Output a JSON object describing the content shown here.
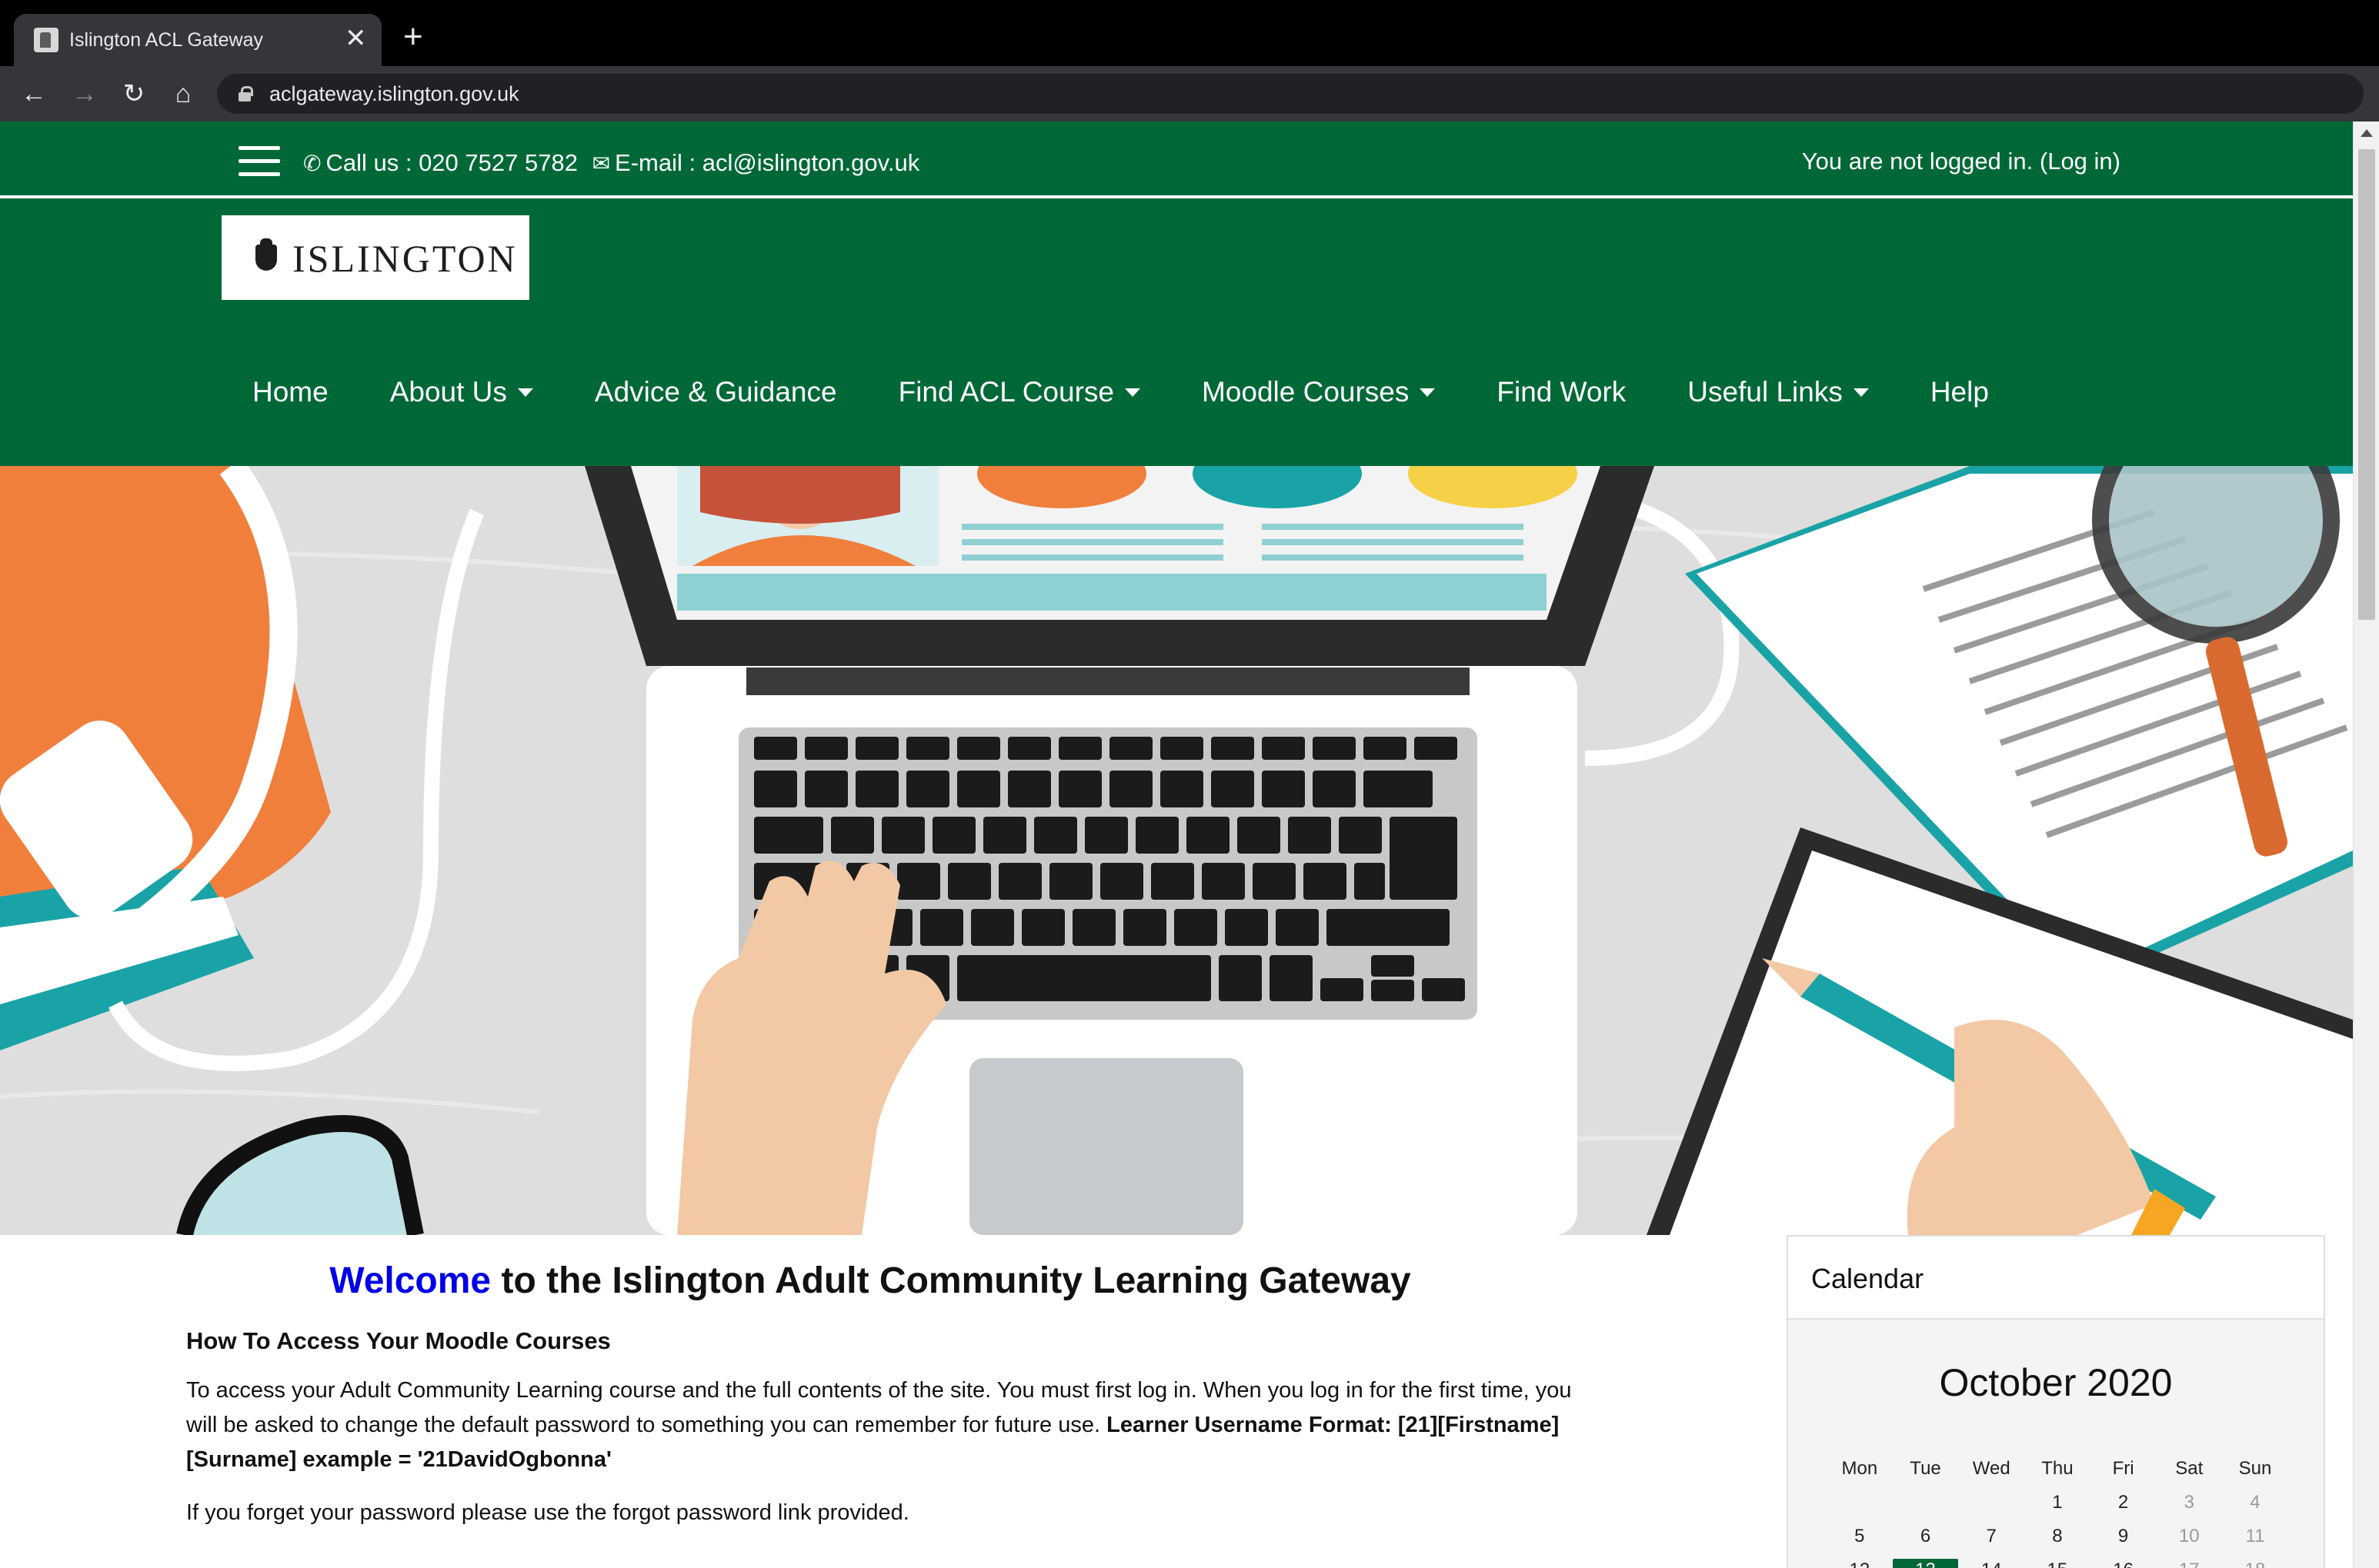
{
  "browser": {
    "tab_title": "Islington ACL Gateway",
    "tab_close": "✕",
    "new_tab": "+",
    "url": "aclgateway.islington.gov.uk",
    "back_icon": "←",
    "forward_icon": "→",
    "reload_icon": "↻",
    "home_icon": "⌂"
  },
  "topbar": {
    "call_text": "Call us : 020 7527 5782",
    "email_text": "E-mail : acl@islington.gov.uk",
    "login_prefix": "You are not logged in. (",
    "login_link": "Log in",
    "login_suffix": ")"
  },
  "logo": {
    "text": "ISLINGTON"
  },
  "nav": {
    "home": "Home",
    "about": "About Us",
    "advice": "Advice & Guidance",
    "find_course": "Find ACL Course",
    "moodle": "Moodle Courses",
    "find_work": "Find Work",
    "useful_links": "Useful Links",
    "help": "Help"
  },
  "content": {
    "welcome_accent": "Welcome",
    "welcome_rest": " to the Islington Adult Community Learning Gateway",
    "subhead": "How To Access Your Moodle Courses",
    "para_text": "To access your Adult Community Learning course and the full contents of the site. You must first log in. When you log in for the first time, you will be asked to change the default password to something you can remember for future use. ",
    "para_bold": "Learner Username Format: [21][Firstname][Surname] example = '21DavidOgbonna'",
    "para2": "If you forget your password please use the forgot password link provided."
  },
  "calendar": {
    "title": "Calendar",
    "month": "October 2020",
    "weekdays": [
      "Mon",
      "Tue",
      "Wed",
      "Thu",
      "Fri",
      "Sat",
      "Sun"
    ],
    "week1": [
      "",
      "",
      "",
      "1",
      "2",
      "3",
      "4"
    ],
    "week2": [
      "5",
      "6",
      "7",
      "8",
      "9",
      "10",
      "11"
    ],
    "week3": [
      "12",
      "13",
      "14",
      "15",
      "16",
      "17",
      "18"
    ],
    "today": "13"
  },
  "colors": {
    "brand_green": "#006837",
    "welcome_blue": "#0000e6"
  }
}
